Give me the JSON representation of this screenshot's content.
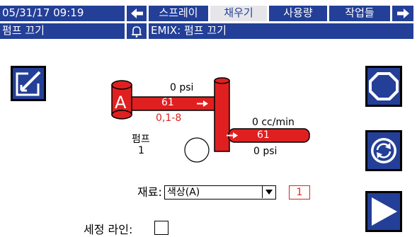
{
  "header": {
    "datetime": "05/31/17 09:19",
    "tabs": [
      {
        "label": "스프레이"
      },
      {
        "label": "채우기"
      },
      {
        "label": "사용량"
      },
      {
        "label": "작업들"
      }
    ],
    "status": "펌프 끄기",
    "event": "EMIX: 펌프 끄기"
  },
  "diagram": {
    "pump_letter": "A",
    "inlet_pressure": "0 psi",
    "flow_top": "61",
    "range": "0,1-8",
    "pump_label": "펌프",
    "pump_number": "1",
    "flow_rate": "0 cc/min",
    "flow_bottom": "61",
    "outlet_pressure": "0 psi"
  },
  "material": {
    "label": "재료:",
    "value": "색상(A)",
    "index": "1"
  },
  "flush": {
    "label": "세정 라인:"
  },
  "colors": {
    "navy": "#233f97",
    "red": "#e02020"
  },
  "icons": {
    "left": "arrow-left-icon",
    "right": "arrow-right-icon",
    "bell": "bell-icon",
    "edit": "edit-icon",
    "stop": "stop-icon",
    "refresh": "refresh-icon",
    "play": "play-icon"
  }
}
